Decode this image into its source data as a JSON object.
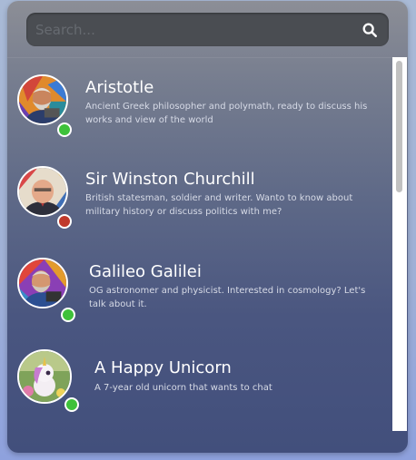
{
  "search": {
    "placeholder": "Search...",
    "value": ""
  },
  "colors": {
    "online": "#3ec13a",
    "busy": "#c0392b"
  },
  "characters": [
    {
      "name": "Aristotle",
      "description": "Ancient Greek philosopher and polymath, ready to discuss his works and view of the world",
      "status": "online"
    },
    {
      "name": "Sir Winston Churchill",
      "description": "British statesman, soldier and writer. Wanto to know about military history or discuss politics with me?",
      "status": "busy"
    },
    {
      "name": "Galileo Galilei",
      "description": "OG astronomer and physicist. Interested in cosmology? Let's talk about it.",
      "status": "online"
    },
    {
      "name": "A Happy Unicorn",
      "description": "A 7-year old unicorn that wants to chat",
      "status": "online"
    }
  ]
}
